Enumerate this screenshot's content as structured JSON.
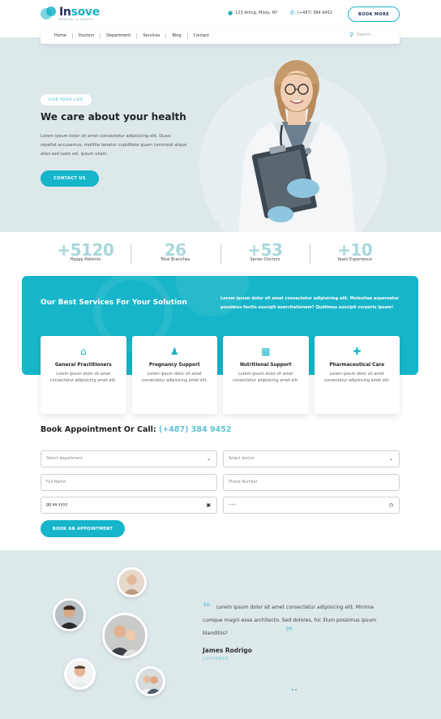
{
  "brand": {
    "name_part1": "In",
    "name_part2": "sove",
    "tagline": "MEDICAL & HEALTH"
  },
  "header": {
    "address": "123 Arling, Miola, NY",
    "phone": "(+487) 384 9452",
    "button_label": "BOOK MORE"
  },
  "nav": {
    "items": [
      "Home",
      "Doctors",
      "Department",
      "Services",
      "Blog",
      "Contact"
    ],
    "search_placeholder": "Search..."
  },
  "hero": {
    "badge": "LIVE YOUR LIFE",
    "title": "We care about your health",
    "text": "Lorem ipsum dolor sit amet consectetur adipisicing elit. Quasi repellat accusamus, mollitia tenetur cupiditate quam commodi atque alias sed iusto vel, ipsum ullam.",
    "button_label": "CONTACT US"
  },
  "stats": [
    {
      "value": "+5120",
      "label": "Happy Patients"
    },
    {
      "value": "26",
      "label": "Total Branches"
    },
    {
      "value": "+53",
      "label": "Senior Doctors"
    },
    {
      "value": "+10",
      "label": "Years Experience"
    }
  ],
  "services": {
    "title": "Our Best Services For Your Solution",
    "text": "Lorem ipsum dolor sit amet consectetur adipisicing elit. Molestiae aspernatur possimus facilis suscipit exercitationem? Quidimus suscipit corporis ipsam!",
    "cards": [
      {
        "icon": "house-medical-icon",
        "title": "General Practitioners",
        "text": "Lorem ipsum dolor sit amet consectetur adipisicing amet elit."
      },
      {
        "icon": "pregnant-person-icon",
        "title": "Pregnancy Support",
        "text": "Lorem ipsum dolor sit amet consectetur adipisicing amet elit."
      },
      {
        "icon": "nutrition-chart-icon",
        "title": "Nutritional Support",
        "text": "Lorem ipsum dolor sit amet consectetur adipisicing amet elit."
      },
      {
        "icon": "prescription-bottle-icon",
        "title": "Pharmaceutical Care",
        "text": "Lorem ipsum dolor sit amet consectetur adipisicing amet elit."
      }
    ]
  },
  "appointment": {
    "title": "Book Appointment Or Call:",
    "phone": "(+487) 384 9452",
    "department_placeholder": "Select department",
    "doctor_placeholder": "Select doctor",
    "name_placeholder": "Full Name",
    "phone_placeholder": "Phone Number",
    "date_placeholder": "gg.aa.yyyy",
    "time_placeholder": "--:--",
    "button_label": "BOOK AN APPOINTMENT"
  },
  "testimonial": {
    "quote": "Lorem ipsum dolor sit amet consectetur adipisicing elit. Minima cumque magni esse architecto. Sed dolores, hic illum possimus ipsum blanditiis?",
    "name": "James Rodrigo",
    "role": "CUSTOMER"
  },
  "colors": {
    "accent": "#16b5c9",
    "navy": "#1d2a55",
    "hero_bg": "#dde8eb",
    "stat_num": "#a9d7de"
  }
}
